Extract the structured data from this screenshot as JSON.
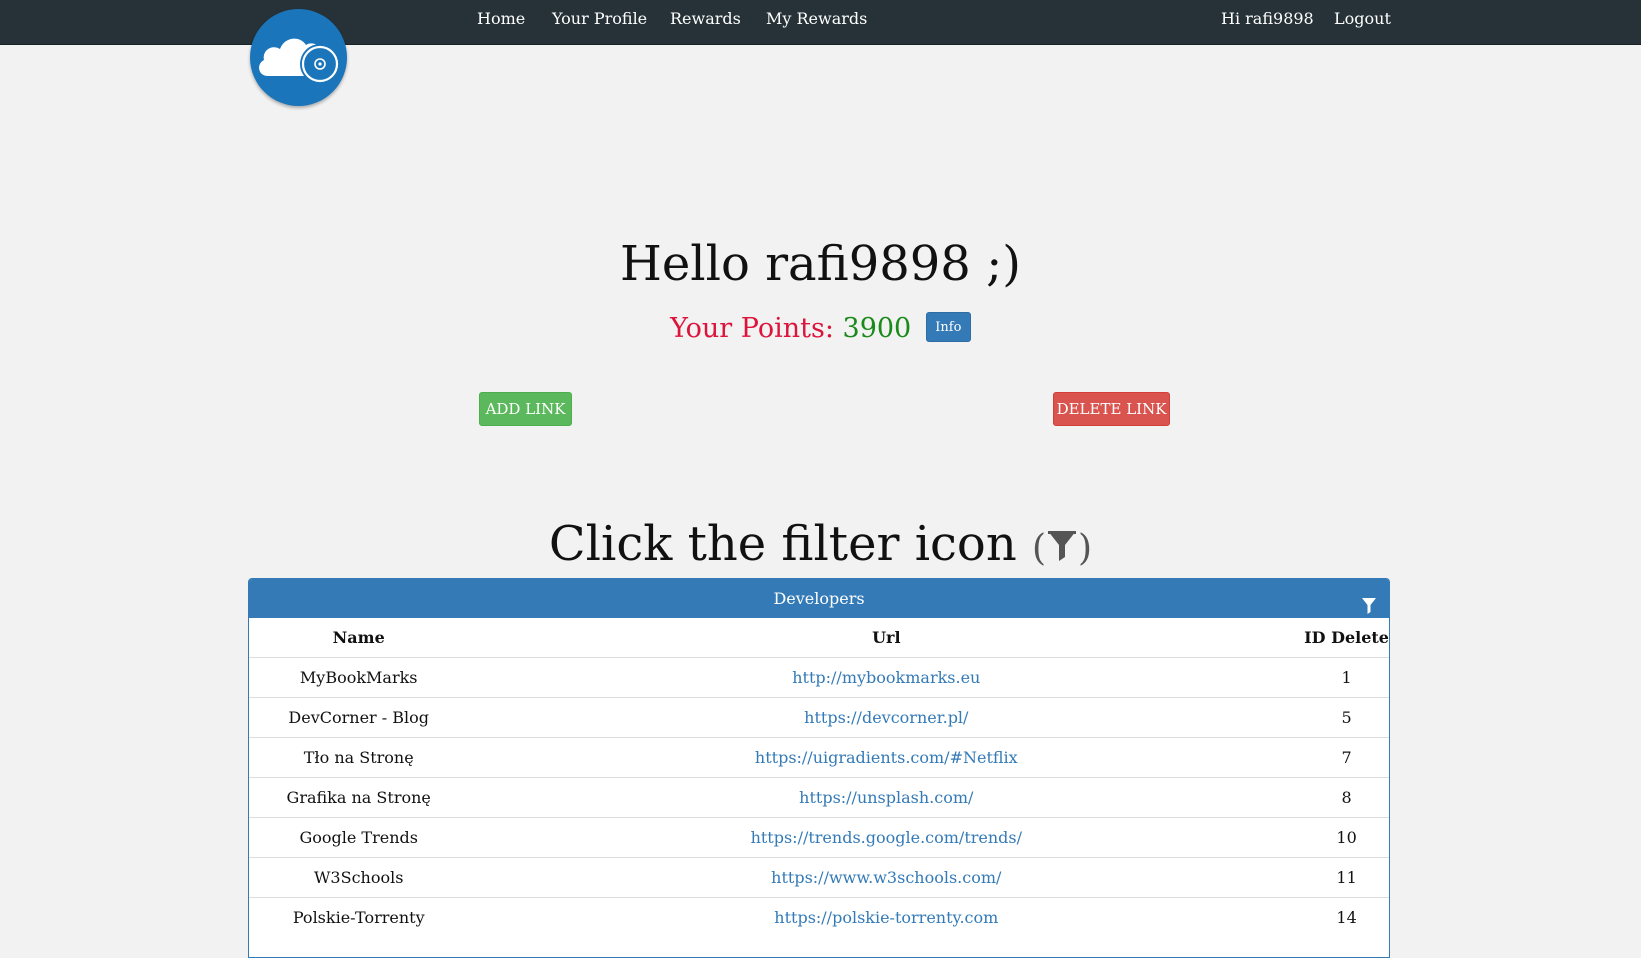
{
  "nav": {
    "home": "Home",
    "profile": "Your Profile",
    "rewards": "Rewards",
    "my_rewards": "My Rewards",
    "greeting": "Hi rafi9898",
    "logout": "Logout"
  },
  "logo": {
    "icon": "cloud-disc-icon",
    "color": "#1b75bb"
  },
  "hero": {
    "greeting": "Hello rafi9898 ;)",
    "points_label": "Your Points: ",
    "points_value": "3900",
    "info_button": "Info"
  },
  "actions": {
    "add_link": "ADD LINK",
    "delete_link": "DELETE LINK"
  },
  "filter_heading": {
    "text": "Click the filter icon ",
    "open_paren": "(",
    "close_paren": ")",
    "icon": "filter-icon"
  },
  "panel": {
    "title": "Developers",
    "columns": {
      "name": "Name",
      "url": "Url",
      "id_delete": "ID Delete"
    },
    "rows": [
      {
        "name": "MyBookMarks",
        "url": "http://mybookmarks.eu",
        "id": "1"
      },
      {
        "name": "DevCorner - Blog",
        "url": "https://devcorner.pl/",
        "id": "5"
      },
      {
        "name": "Tło na Stronę",
        "url": "https://uigradients.com/#Netflix",
        "id": "7"
      },
      {
        "name": "Grafika na Stronę",
        "url": "https://unsplash.com/",
        "id": "8"
      },
      {
        "name": "Google Trends",
        "url": "https://trends.google.com/trends/",
        "id": "10"
      },
      {
        "name": "W3Schools",
        "url": "https://www.w3schools.com/",
        "id": "11"
      },
      {
        "name": "Polskie-Torrenty",
        "url": "https://polskie-torrenty.com",
        "id": "14"
      }
    ]
  },
  "colors": {
    "navbar": "#263238",
    "primary": "#337ab7",
    "success": "#5cb85c",
    "danger": "#d9534f",
    "points_label": "#dc143c",
    "points_value": "#1a8a1a",
    "background": "#f2f2f2"
  }
}
